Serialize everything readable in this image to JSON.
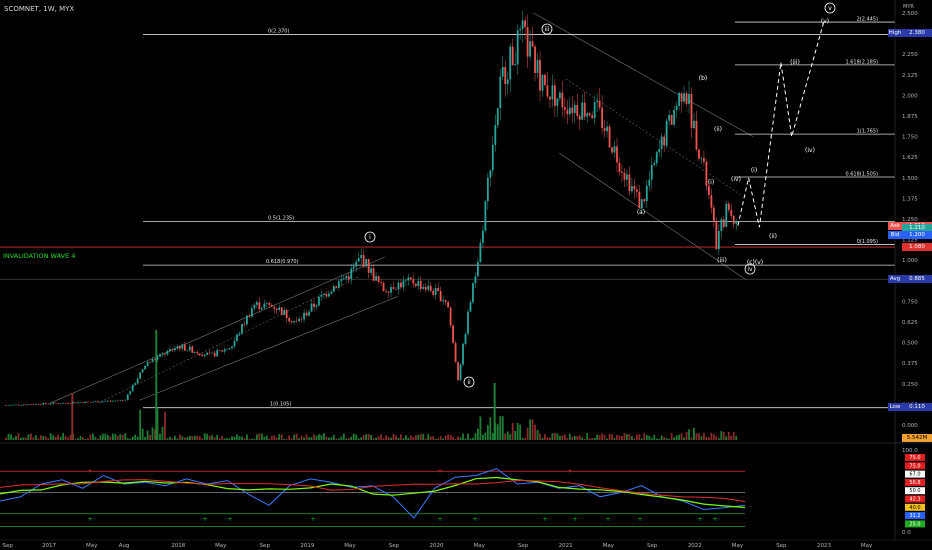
{
  "header": {
    "symbol": "SCOMNET, 1W, MYX"
  },
  "invalidation_label": "INVALIDATION WAVE 4",
  "price_axis": {
    "ticks": [
      "2.500",
      "2.375",
      "2.250",
      "2.125",
      "2.000",
      "1.875",
      "1.750",
      "1.625",
      "1.500",
      "1.375",
      "1.250",
      "1.125",
      "1.000",
      "0.875",
      "0.750",
      "0.625",
      "0.500",
      "0.375",
      "0.250",
      "0.125",
      "0.000"
    ],
    "tags": [
      {
        "label": "High",
        "value": "2.380",
        "bg": "#2a3aa8",
        "fg": "#ffffff",
        "price": 2.38
      },
      {
        "label": "Ask",
        "value": "1.210",
        "bg": "#ef5350",
        "fg": "#ffffff",
        "price": 1.21
      },
      {
        "label": "",
        "value": "1.210",
        "bg": "#26a69a",
        "fg": "#ffffff",
        "price": 1.195
      },
      {
        "label": "Bid",
        "value": "1.200",
        "bg": "#2962ff",
        "fg": "#ffffff",
        "price": 1.15
      },
      {
        "label": "",
        "value": "1.080",
        "bg": "#e03030",
        "fg": "#ffffff",
        "price": 1.08
      },
      {
        "label": "Avg",
        "value": "0.885",
        "bg": "#2a3aa8",
        "fg": "#ffffff",
        "price": 0.885
      },
      {
        "label": "Low",
        "value": "0.110",
        "bg": "#2a3aa8",
        "fg": "#ffffff",
        "price": 0.11
      },
      {
        "label": "",
        "value": "5.542M",
        "bg": "#f0a030",
        "fg": "#000000",
        "price": -0.02
      }
    ],
    "top_badge": "MYR"
  },
  "time_axis": [
    "Sep",
    "2017",
    "May",
    "Aug",
    "2018",
    "May",
    "Sep",
    "2019",
    "May",
    "Sep",
    "2020",
    "May",
    "Sep",
    "2021",
    "May",
    "Sep",
    "2022",
    "May",
    "Sep",
    "2023",
    "May"
  ],
  "fib_levels": [
    {
      "label": "0(2.370)",
      "price": 2.37
    },
    {
      "label": "0.5(1.235)",
      "price": 1.235
    },
    {
      "label": "0.618(0.970)",
      "price": 0.97
    },
    {
      "label": "1(0.105)",
      "price": 0.105
    }
  ],
  "projection_fibs": [
    {
      "label": "2(2.445)",
      "price": 2.445
    },
    {
      "label": "1.618(2.185)",
      "price": 2.185
    },
    {
      "label": "1(1.765)",
      "price": 1.765
    },
    {
      "label": "0.618(1.505)",
      "price": 1.505
    },
    {
      "label": "0(1.095)",
      "price": 1.095
    }
  ],
  "wave_labels": [
    {
      "text": "i",
      "circled": true
    },
    {
      "text": "ii",
      "circled": true
    },
    {
      "text": "iii",
      "circled": true
    },
    {
      "text": "iv",
      "circled": true
    },
    {
      "text": "v",
      "circled": true
    },
    {
      "text": "(a)",
      "circled": false
    },
    {
      "text": "(b)",
      "circled": false
    },
    {
      "text": "(c)(v)",
      "circled": false
    },
    {
      "text": "(i)",
      "circled": false
    },
    {
      "text": "(ii)",
      "circled": false
    },
    {
      "text": "(iii)",
      "circled": false
    },
    {
      "text": "(iv)",
      "circled": false
    },
    {
      "text": "(i)",
      "circled": false
    },
    {
      "text": "(ii)",
      "circled": false
    },
    {
      "text": "(iii)",
      "circled": false
    },
    {
      "text": "(iv)",
      "circled": false
    },
    {
      "text": "(v)",
      "circled": false
    }
  ],
  "rsi_axis": {
    "ticks": [
      "100.0",
      "0.0"
    ],
    "tags": [
      {
        "value": "75.0",
        "bg": "#e02020",
        "fg": "#ffffff"
      },
      {
        "value": "75.0",
        "bg": "#e02020",
        "fg": "#ffffff"
      },
      {
        "value": "67.0",
        "bg": "#ffffff",
        "fg": "#000000"
      },
      {
        "value": "56.8",
        "bg": "#e02020",
        "fg": "#ffffff"
      },
      {
        "value": "50.0",
        "bg": "#ffffff",
        "fg": "#000000"
      },
      {
        "value": "42.3",
        "bg": "#e02020",
        "fg": "#ffffff"
      },
      {
        "value": "40.0",
        "bg": "#f0c020",
        "fg": "#000000"
      },
      {
        "value": "31.2",
        "bg": "#2962ff",
        "fg": "#ffffff"
      },
      {
        "value": "25.0",
        "bg": "#22aa22",
        "fg": "#ffffff"
      }
    ]
  },
  "chart_data": {
    "type": "line",
    "title": "SCOMNET, 1W, MYX",
    "price_range": [
      0.0,
      2.5
    ],
    "price_series": [
      {
        "date": "2016-09",
        "price": 0.12
      },
      {
        "date": "2017-01",
        "price": 0.13
      },
      {
        "date": "2017-05",
        "price": 0.14
      },
      {
        "date": "2017-08",
        "price": 0.15
      },
      {
        "date": "2017-10",
        "price": 0.37
      },
      {
        "date": "2018-01",
        "price": 0.48
      },
      {
        "date": "2018-04",
        "price": 0.42
      },
      {
        "date": "2018-06",
        "price": 0.48
      },
      {
        "date": "2018-08",
        "price": 0.73
      },
      {
        "date": "2018-10",
        "price": 0.72
      },
      {
        "date": "2018-12",
        "price": 0.62
      },
      {
        "date": "2019-03",
        "price": 0.82
      },
      {
        "date": "2019-05",
        "price": 0.92
      },
      {
        "date": "2019-06",
        "price": 1.02
      },
      {
        "date": "2019-08",
        "price": 0.82
      },
      {
        "date": "2019-09",
        "price": 0.85
      },
      {
        "date": "2019-11",
        "price": 0.87
      },
      {
        "date": "2020-01",
        "price": 0.8
      },
      {
        "date": "2020-02",
        "price": 0.75
      },
      {
        "date": "2020-03",
        "price": 0.28
      },
      {
        "date": "2020-04",
        "price": 0.7
      },
      {
        "date": "2020-05",
        "price": 1.05
      },
      {
        "date": "2020-06",
        "price": 1.6
      },
      {
        "date": "2020-07",
        "price": 2.1
      },
      {
        "date": "2020-09",
        "price": 2.37
      },
      {
        "date": "2020-11",
        "price": 2.05
      },
      {
        "date": "2021-01",
        "price": 1.95
      },
      {
        "date": "2021-04",
        "price": 1.9
      },
      {
        "date": "2021-06",
        "price": 1.6
      },
      {
        "date": "2021-08",
        "price": 1.33
      },
      {
        "date": "2021-10",
        "price": 1.72
      },
      {
        "date": "2021-12",
        "price": 2.07
      },
      {
        "date": "2022-02",
        "price": 1.5
      },
      {
        "date": "2022-03",
        "price": 1.1
      },
      {
        "date": "2022-04",
        "price": 1.32
      },
      {
        "date": "2022-05",
        "price": 1.21
      }
    ],
    "projection": [
      {
        "date": "2022-05",
        "price": 1.21
      },
      {
        "date": "2022-06",
        "price": 1.5
      },
      {
        "date": "2022-07",
        "price": 1.2
      },
      {
        "date": "2022-09",
        "price": 2.2
      },
      {
        "date": "2022-10",
        "price": 1.75
      },
      {
        "date": "2023-01",
        "price": 2.45
      }
    ],
    "rsi_series": [
      40,
      45,
      60,
      65,
      55,
      70,
      60,
      62,
      58,
      66,
      60,
      64,
      48,
      35,
      58,
      66,
      62,
      56,
      58,
      45,
      20,
      55,
      68,
      70,
      78,
      60,
      62,
      55,
      58,
      45,
      50,
      58,
      45,
      40,
      30,
      32,
      35
    ],
    "rsi_range": [
      0,
      100
    ]
  }
}
